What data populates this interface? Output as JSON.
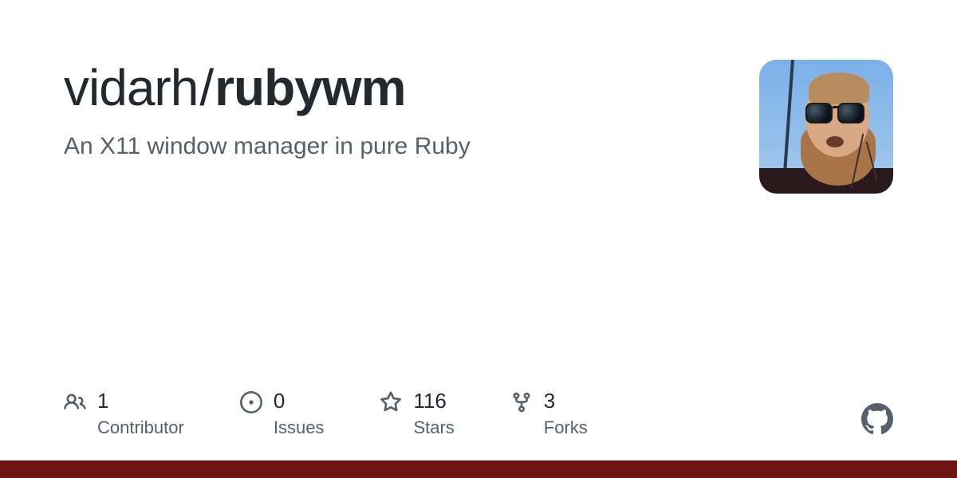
{
  "repo": {
    "owner": "vidarh",
    "name": "rubywm",
    "description": "An X11 window manager in pure Ruby"
  },
  "stats": {
    "contributors": {
      "value": "1",
      "label": "Contributor"
    },
    "issues": {
      "value": "0",
      "label": "Issues"
    },
    "stars": {
      "value": "116",
      "label": "Stars"
    },
    "forks": {
      "value": "3",
      "label": "Forks"
    }
  },
  "colors": {
    "accent_bar": "#6f1414"
  }
}
